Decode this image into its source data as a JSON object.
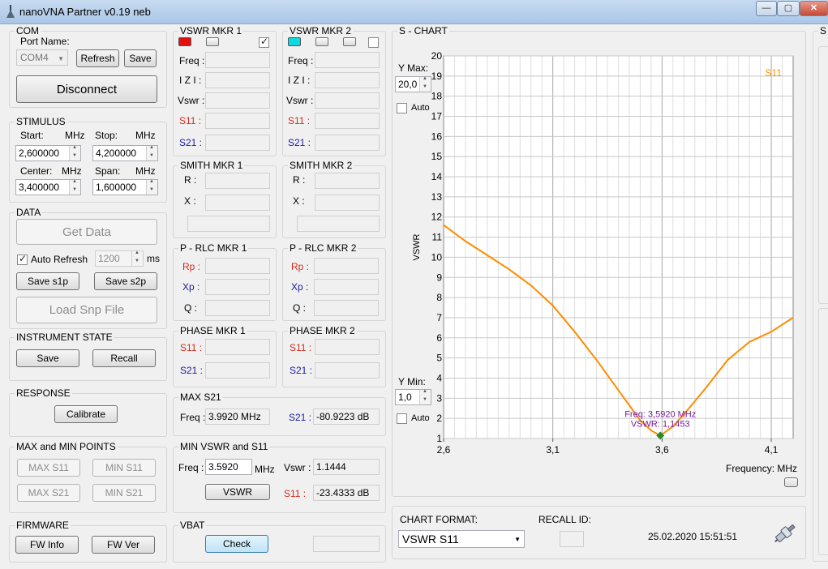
{
  "window": {
    "title": "nanoVNA Partner v0.19 neb"
  },
  "com": {
    "label": "COM",
    "port_name_label": "Port Name:",
    "port_value": "COM4",
    "refresh": "Refresh",
    "save": "Save",
    "disconnect": "Disconnect"
  },
  "stimulus": {
    "label": "STIMULUS",
    "start_label": "Start:",
    "start_unit": "MHz",
    "start_value": "2,600000",
    "stop_label": "Stop:",
    "stop_unit": "MHz",
    "stop_value": "4,200000",
    "center_label": "Center:",
    "center_unit": "MHz",
    "center_value": "3,400000",
    "span_label": "Span:",
    "span_unit": "MHz",
    "span_value": "1,600000"
  },
  "data_group": {
    "label": "DATA",
    "get_data": "Get Data",
    "auto_refresh": "Auto Refresh",
    "auto_refresh_checked": true,
    "interval_value": "1200",
    "interval_unit": "ms",
    "save_s1p": "Save s1p",
    "save_s2p": "Save s2p",
    "load_snp": "Load Snp File"
  },
  "instrument_state": {
    "label": "INSTRUMENT STATE",
    "save": "Save",
    "recall": "Recall"
  },
  "response": {
    "label": "RESPONSE",
    "calibrate": "Calibrate"
  },
  "maxmin": {
    "label": "MAX and MIN POINTS",
    "max_s11": "MAX S11",
    "min_s11": "MIN S11",
    "max_s21": "MAX S21",
    "min_s21": "MIN S21"
  },
  "firmware": {
    "label": "FIRMWARE",
    "fw_info": "FW Info",
    "fw_ver": "FW Ver"
  },
  "vswr_mkr1": {
    "label": "VSWR MKR 1",
    "color": "#e01010",
    "freq": "Freq :",
    "z": "I Z I :",
    "vswr": "Vswr :",
    "s11": "S11 :",
    "s21": "S21 :"
  },
  "vswr_mkr2": {
    "label": "VSWR MKR 2",
    "color": "#10d8e0",
    "freq": "Freq :",
    "z": "I Z I :",
    "vswr": "Vswr :",
    "s11": "S11 :",
    "s21": "S21 :"
  },
  "smith_mkr1": {
    "label": "SMITH MKR 1",
    "r": "R :",
    "x": "X :"
  },
  "smith_mkr2": {
    "label": "SMITH MKR 2",
    "r": "R :",
    "x": "X :"
  },
  "prlc_mkr1": {
    "label": "P - RLC MKR 1",
    "rp": "Rp :",
    "xp": "Xp :",
    "q": "Q :"
  },
  "prlc_mkr2": {
    "label": "P - RLC MKR 2",
    "rp": "Rp :",
    "xp": "Xp :",
    "q": "Q :"
  },
  "phase_mkr1": {
    "label": "PHASE MKR 1",
    "s11": "S11 :",
    "s21": "S21 :"
  },
  "phase_mkr2": {
    "label": "PHASE MKR 2",
    "s11": "S11 :",
    "s21": "S21 :"
  },
  "max_s21": {
    "label": "MAX S21",
    "freq_label": "Freq :",
    "freq_value": "3.9920 MHz",
    "s21_label": "S21 :",
    "s21_value": "-80.9223 dB"
  },
  "min_vswr": {
    "label": "MIN VSWR and S11",
    "freq_label": "Freq :",
    "freq_value": "3.5920",
    "freq_unit": "MHz",
    "vswr_label": "Vswr :",
    "vswr_value": "1.1444",
    "vswr_button": "VSWR",
    "s11_label": "S11 :",
    "s11_value": "-23.4333 dB"
  },
  "vbat": {
    "label": "VBAT",
    "check": "Check"
  },
  "schart": {
    "label": "S - CHART",
    "ymax_label": "Y Max:",
    "ymax_value": "20,0",
    "auto1": "Auto",
    "ymin_label": "Y Min:",
    "ymin_value": "1,0",
    "auto2": "Auto",
    "xlabel_text": "Frequency: MHz"
  },
  "chart_format": {
    "label": "CHART FORMAT:",
    "value": "VSWR S11",
    "recall_label": "RECALL ID:",
    "timestamp": "25.02.2020 15:51:51"
  },
  "right_panel": {
    "label": "S"
  },
  "chart_data": {
    "type": "line",
    "title": "",
    "xlabel": "Frequency: MHz",
    "ylabel": "VSWR",
    "xlim": [
      2.6,
      4.2
    ],
    "ylim": [
      1,
      20
    ],
    "x_ticks": [
      "2,6",
      "3,1",
      "3,6",
      "4,1"
    ],
    "x_tick_values": [
      2.6,
      3.1,
      3.6,
      4.1
    ],
    "y_ticks": [
      1,
      2,
      3,
      4,
      5,
      6,
      7,
      8,
      9,
      10,
      11,
      12,
      13,
      14,
      15,
      16,
      17,
      18,
      19,
      20
    ],
    "grid": true,
    "legend": "top-right",
    "series": [
      {
        "name": "S11",
        "color": "#ff8c00",
        "x": [
          2.6,
          2.7,
          2.8,
          2.9,
          3.0,
          3.1,
          3.2,
          3.3,
          3.4,
          3.5,
          3.55,
          3.592,
          3.65,
          3.7,
          3.8,
          3.9,
          4.0,
          4.1,
          4.2
        ],
        "y": [
          11.6,
          10.8,
          10.1,
          9.4,
          8.6,
          7.6,
          6.3,
          4.9,
          3.4,
          1.9,
          1.4,
          1.145,
          1.6,
          2.2,
          3.5,
          4.9,
          5.8,
          6.3,
          7.0
        ]
      }
    ],
    "marker": {
      "x": 3.592,
      "y": 1.1453,
      "label1": "Freq: 3,5920 MHz",
      "label2": "VSWR: 1,1453",
      "color": "#2a8a2a",
      "text_color": "#7a1a9a"
    }
  }
}
